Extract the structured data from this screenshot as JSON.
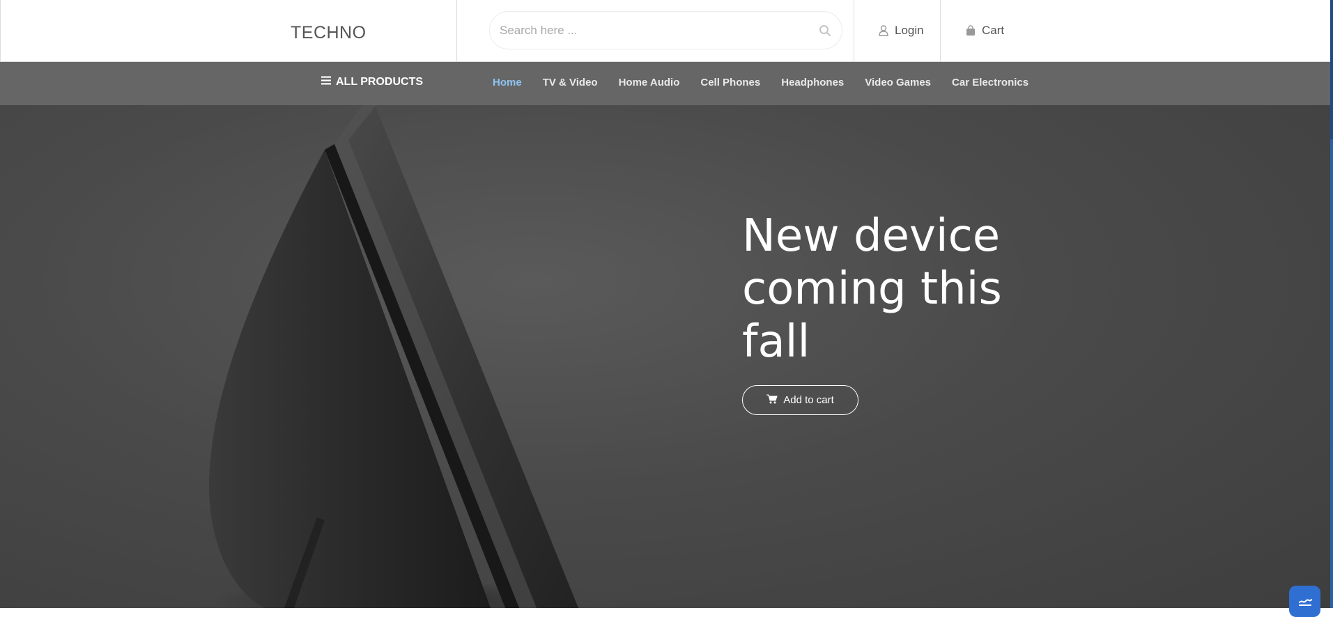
{
  "header": {
    "logo": "TECHNO",
    "search": {
      "placeholder": "Search here ...",
      "value": ""
    },
    "login_label": "Login",
    "cart_label": "Cart"
  },
  "nav": {
    "all_products_label": "ALL PRODUCTS",
    "items": [
      {
        "label": "Home",
        "active": true
      },
      {
        "label": "TV & Video",
        "active": false
      },
      {
        "label": "Home Audio",
        "active": false
      },
      {
        "label": "Cell Phones",
        "active": false
      },
      {
        "label": "Headphones",
        "active": false
      },
      {
        "label": "Video Games",
        "active": false
      },
      {
        "label": "Car Electronics",
        "active": false
      }
    ]
  },
  "hero": {
    "heading": "New device coming this fall",
    "button_label": "Add to cart"
  },
  "icons": {
    "search": "search-icon",
    "login": "user-icon",
    "cart": "shopping-bag-icon",
    "menu": "hamburger-menu-icon",
    "add_to_cart": "shopping-cart-icon",
    "chat": "accessibility-icon"
  },
  "colors": {
    "nav_background": "#666666",
    "nav_active": "#8fc3f0",
    "hero_background": "#4a4a4a",
    "header_text": "#555555",
    "accent_blue": "#2f6fd1"
  }
}
